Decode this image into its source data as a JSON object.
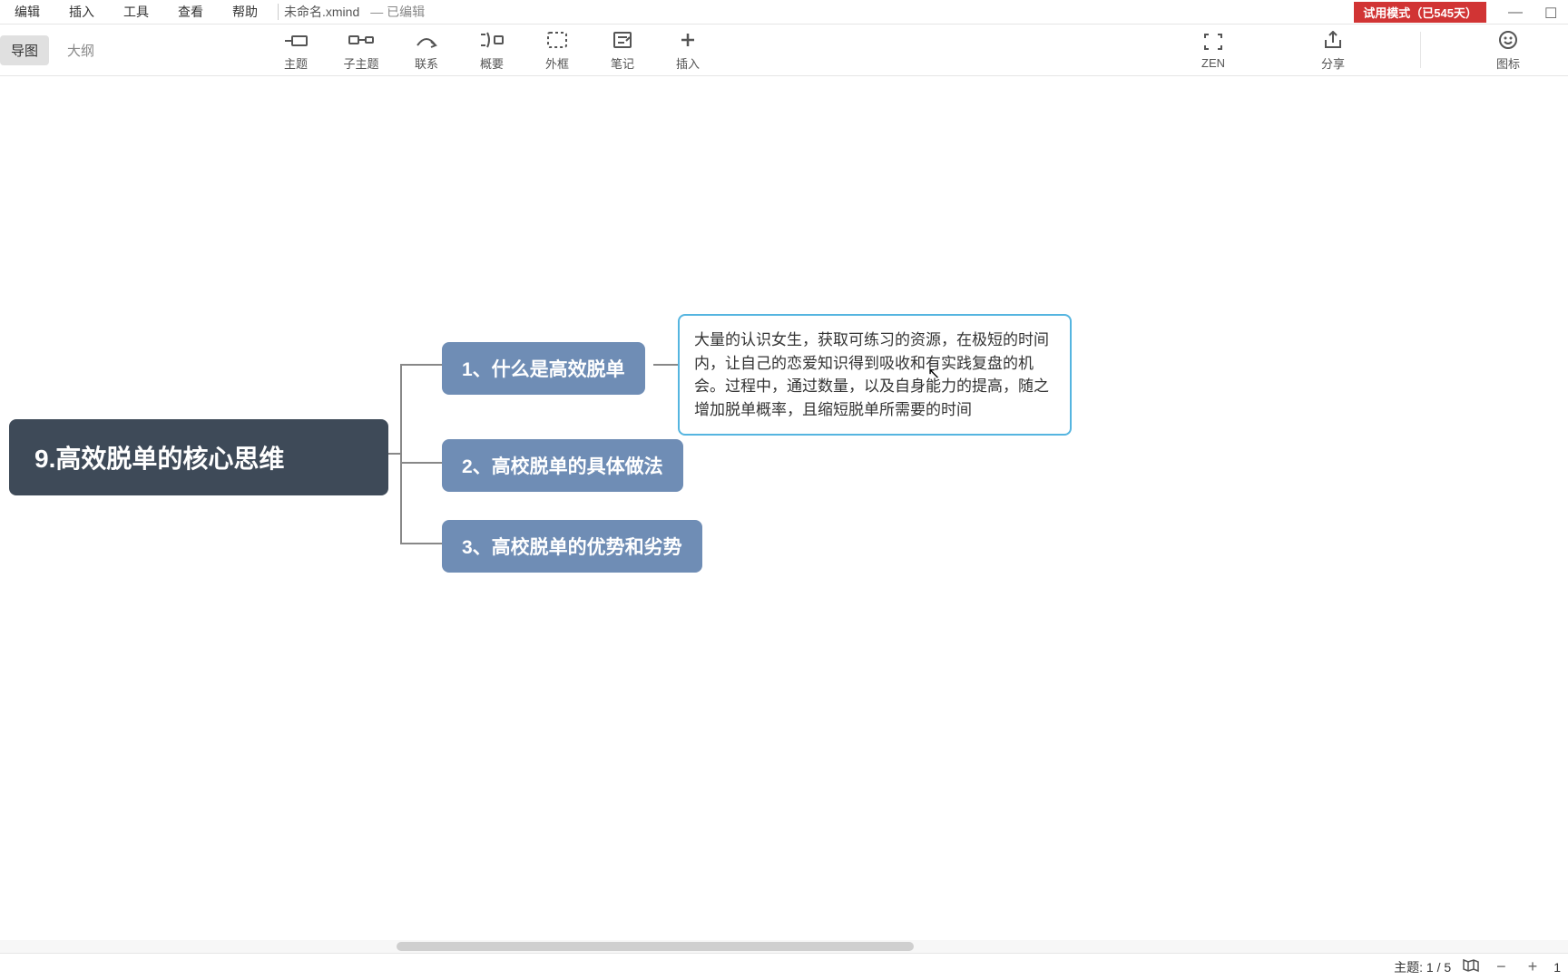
{
  "menu": {
    "edit": "编辑",
    "insert": "插入",
    "tools": "工具",
    "view": "查看",
    "help": "帮助"
  },
  "file": {
    "name": "未命名.xmind",
    "status": "已编辑"
  },
  "trial": "试用模式（已545天）",
  "tabs": {
    "map": "导图",
    "outline": "大纲"
  },
  "toolbar": {
    "topic": "主题",
    "subtopic": "子主题",
    "relation": "联系",
    "summary": "概要",
    "boundary": "外框",
    "note": "笔记",
    "insert": "插入",
    "zen": "ZEN",
    "share": "分享",
    "icons": "图标"
  },
  "mindmap": {
    "root": "9.高效脱单的核心思维",
    "child1": "1、什么是高效脱单",
    "child2": "2、高校脱单的具体做法",
    "child3": "3、高校脱单的优势和劣势",
    "note": "大量的认识女生，获取可练习的资源，在极短的时间内，让自己的恋爱知识得到吸收和有实践复盘的机会。过程中，通过数量，以及自身能力的提高，随之增加脱单概率，且缩短脱单所需要的时间"
  },
  "status": {
    "topic_count": "主题: 1 / 5",
    "zoom": "1"
  }
}
